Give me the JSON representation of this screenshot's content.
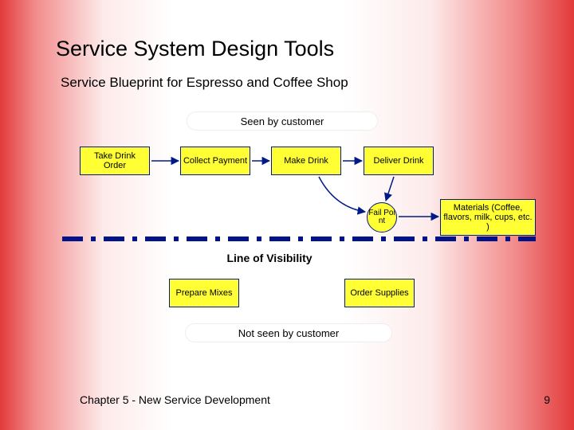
{
  "title": "Service System Design Tools",
  "subtitle": "Service Blueprint for Espresso and Coffee Shop",
  "labels": {
    "seen": "Seen by customer",
    "lov": "Line of Visibility",
    "notseen": "Not seen by customer"
  },
  "steps": {
    "take": "Take Drink Order",
    "collect": "Collect Payment",
    "make": "Make Drink",
    "deliver": "Deliver Drink",
    "prepare": "Prepare Mixes",
    "order": "Order Supplies"
  },
  "fail": "Fail Poi nt",
  "materials": "Materials (Coffee, flavors, milk, cups, etc. )",
  "footer": {
    "left": "Chapter 5 - New Service Development",
    "page": "9"
  }
}
